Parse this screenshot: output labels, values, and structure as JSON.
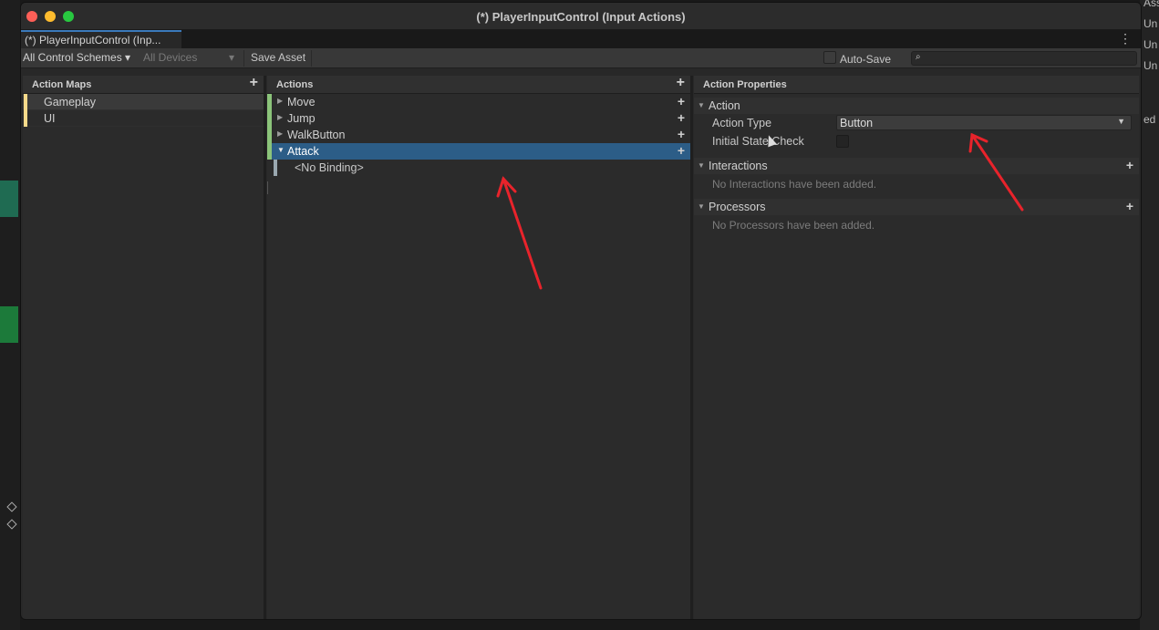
{
  "window": {
    "title": "(*) PlayerInputControl (Input Actions)",
    "tab_label": "(*) PlayerInputControl (Inp...",
    "menu_icon": "kebab-menu-icon"
  },
  "toolbar": {
    "control_schemes": "All Control Schemes ▾",
    "devices": "All Devices",
    "devices_arrow": "▾",
    "save_asset": "Save Asset",
    "auto_save": "Auto-Save",
    "auto_save_checked": false,
    "search_placeholder": ""
  },
  "action_maps": {
    "header": "Action Maps",
    "items": [
      {
        "label": "Gameplay",
        "selected": true
      },
      {
        "label": "UI",
        "selected": false
      }
    ]
  },
  "actions": {
    "header": "Actions",
    "items": [
      {
        "label": "Move",
        "expanded": false,
        "selected": false
      },
      {
        "label": "Jump",
        "expanded": false,
        "selected": false
      },
      {
        "label": "WalkButton",
        "expanded": false,
        "selected": false
      },
      {
        "label": "Attack",
        "expanded": true,
        "selected": true
      }
    ],
    "binding": "<No Binding>"
  },
  "properties": {
    "header": "Action Properties",
    "action_section": "Action",
    "action_type_label": "Action Type",
    "action_type_value": "Button",
    "initial_state_label": "Initial State Check",
    "initial_state_checked": false,
    "interactions_section": "Interactions",
    "interactions_empty": "No Interactions have been added.",
    "processors_section": "Processors",
    "processors_empty": "No Processors have been added."
  },
  "background_right_labels": [
    "Asset",
    "Un",
    "Un",
    "Un",
    "ed"
  ],
  "colors": {
    "accent_blue": "#3a79bb",
    "selection": "#2c5d87",
    "map_marker": "#f5d98a",
    "action_marker": "#8bc47a",
    "annotation_arrow": "#e8232b"
  }
}
